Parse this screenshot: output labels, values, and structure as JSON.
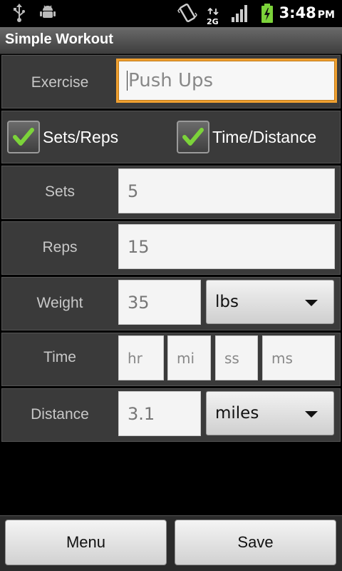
{
  "status_bar": {
    "time": "3:48",
    "ampm": "PM",
    "network": "2G",
    "icons": [
      "usb-icon",
      "android-debug-icon",
      "vibrate-icon",
      "network-2g-icon",
      "signal-icon",
      "battery-charging-icon"
    ]
  },
  "app": {
    "title": "Simple Workout"
  },
  "form": {
    "exercise": {
      "label": "Exercise",
      "placeholder": "Push Ups",
      "value": ""
    },
    "modes": {
      "sets_reps": {
        "label": "Sets/Reps",
        "checked": true
      },
      "time_distance": {
        "label": "Time/Distance",
        "checked": true
      }
    },
    "sets": {
      "label": "Sets",
      "placeholder": "5"
    },
    "reps": {
      "label": "Reps",
      "placeholder": "15"
    },
    "weight": {
      "label": "Weight",
      "placeholder": "35",
      "unit": "lbs"
    },
    "time": {
      "label": "Time",
      "hr": "hr",
      "mi": "mi",
      "ss": "ss",
      "ms": "ms"
    },
    "distance": {
      "label": "Distance",
      "placeholder": "3.1",
      "unit": "miles"
    }
  },
  "buttons": {
    "menu": "Menu",
    "save": "Save"
  },
  "colors": {
    "focus": "#f0a030",
    "check": "#7cd33a",
    "row_bg": "#3a3a3a"
  }
}
